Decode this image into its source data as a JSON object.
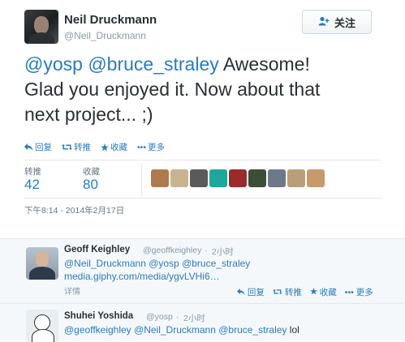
{
  "main_tweet": {
    "author_name": "Neil Druckmann",
    "author_handle": "@Neil_Druckmann",
    "follow_label": "关注",
    "mention1": "@yosp",
    "mention2": "@bruce_straley",
    "text_line1_rest": "Awesome!",
    "text_line2": "Glad you enjoyed it. Now about that",
    "text_line3": "next project... ;)",
    "actions": {
      "reply": "回复",
      "retweet": "转推",
      "favorite": "收藏",
      "more": "更多"
    },
    "stats": {
      "retweets_label": "转推",
      "retweets_count": "42",
      "favorites_label": "收藏",
      "favorites_count": "80"
    },
    "timestamp": "下午8:14 - 2014年2月17日"
  },
  "thumb_colors": [
    "#b07a4f",
    "#c8b48e",
    "#5a5a5a",
    "#1fa79b",
    "#9b2b2b",
    "#3c4d3a",
    "#6d7888",
    "#b89f7a",
    "#c79a6b"
  ],
  "replies": [
    {
      "name": "Geoff Keighley",
      "handle": "@geoffkeighley",
      "time": "2小时",
      "line1": "@Neil_Druckmann @yosp @bruce_straley",
      "line2": "media.giphy.com/media/ygvLVHi6…",
      "detail": "详情",
      "actions": {
        "reply": "回复",
        "retweet": "转推",
        "favorite": "收藏",
        "more": "更多"
      }
    },
    {
      "name": "Shuhei Yoshida",
      "handle": "@yosp",
      "time": "2小时",
      "mentions": "@geoffkeighley @Neil_Druckmann @bruce_straley",
      "rest": "lol"
    }
  ]
}
